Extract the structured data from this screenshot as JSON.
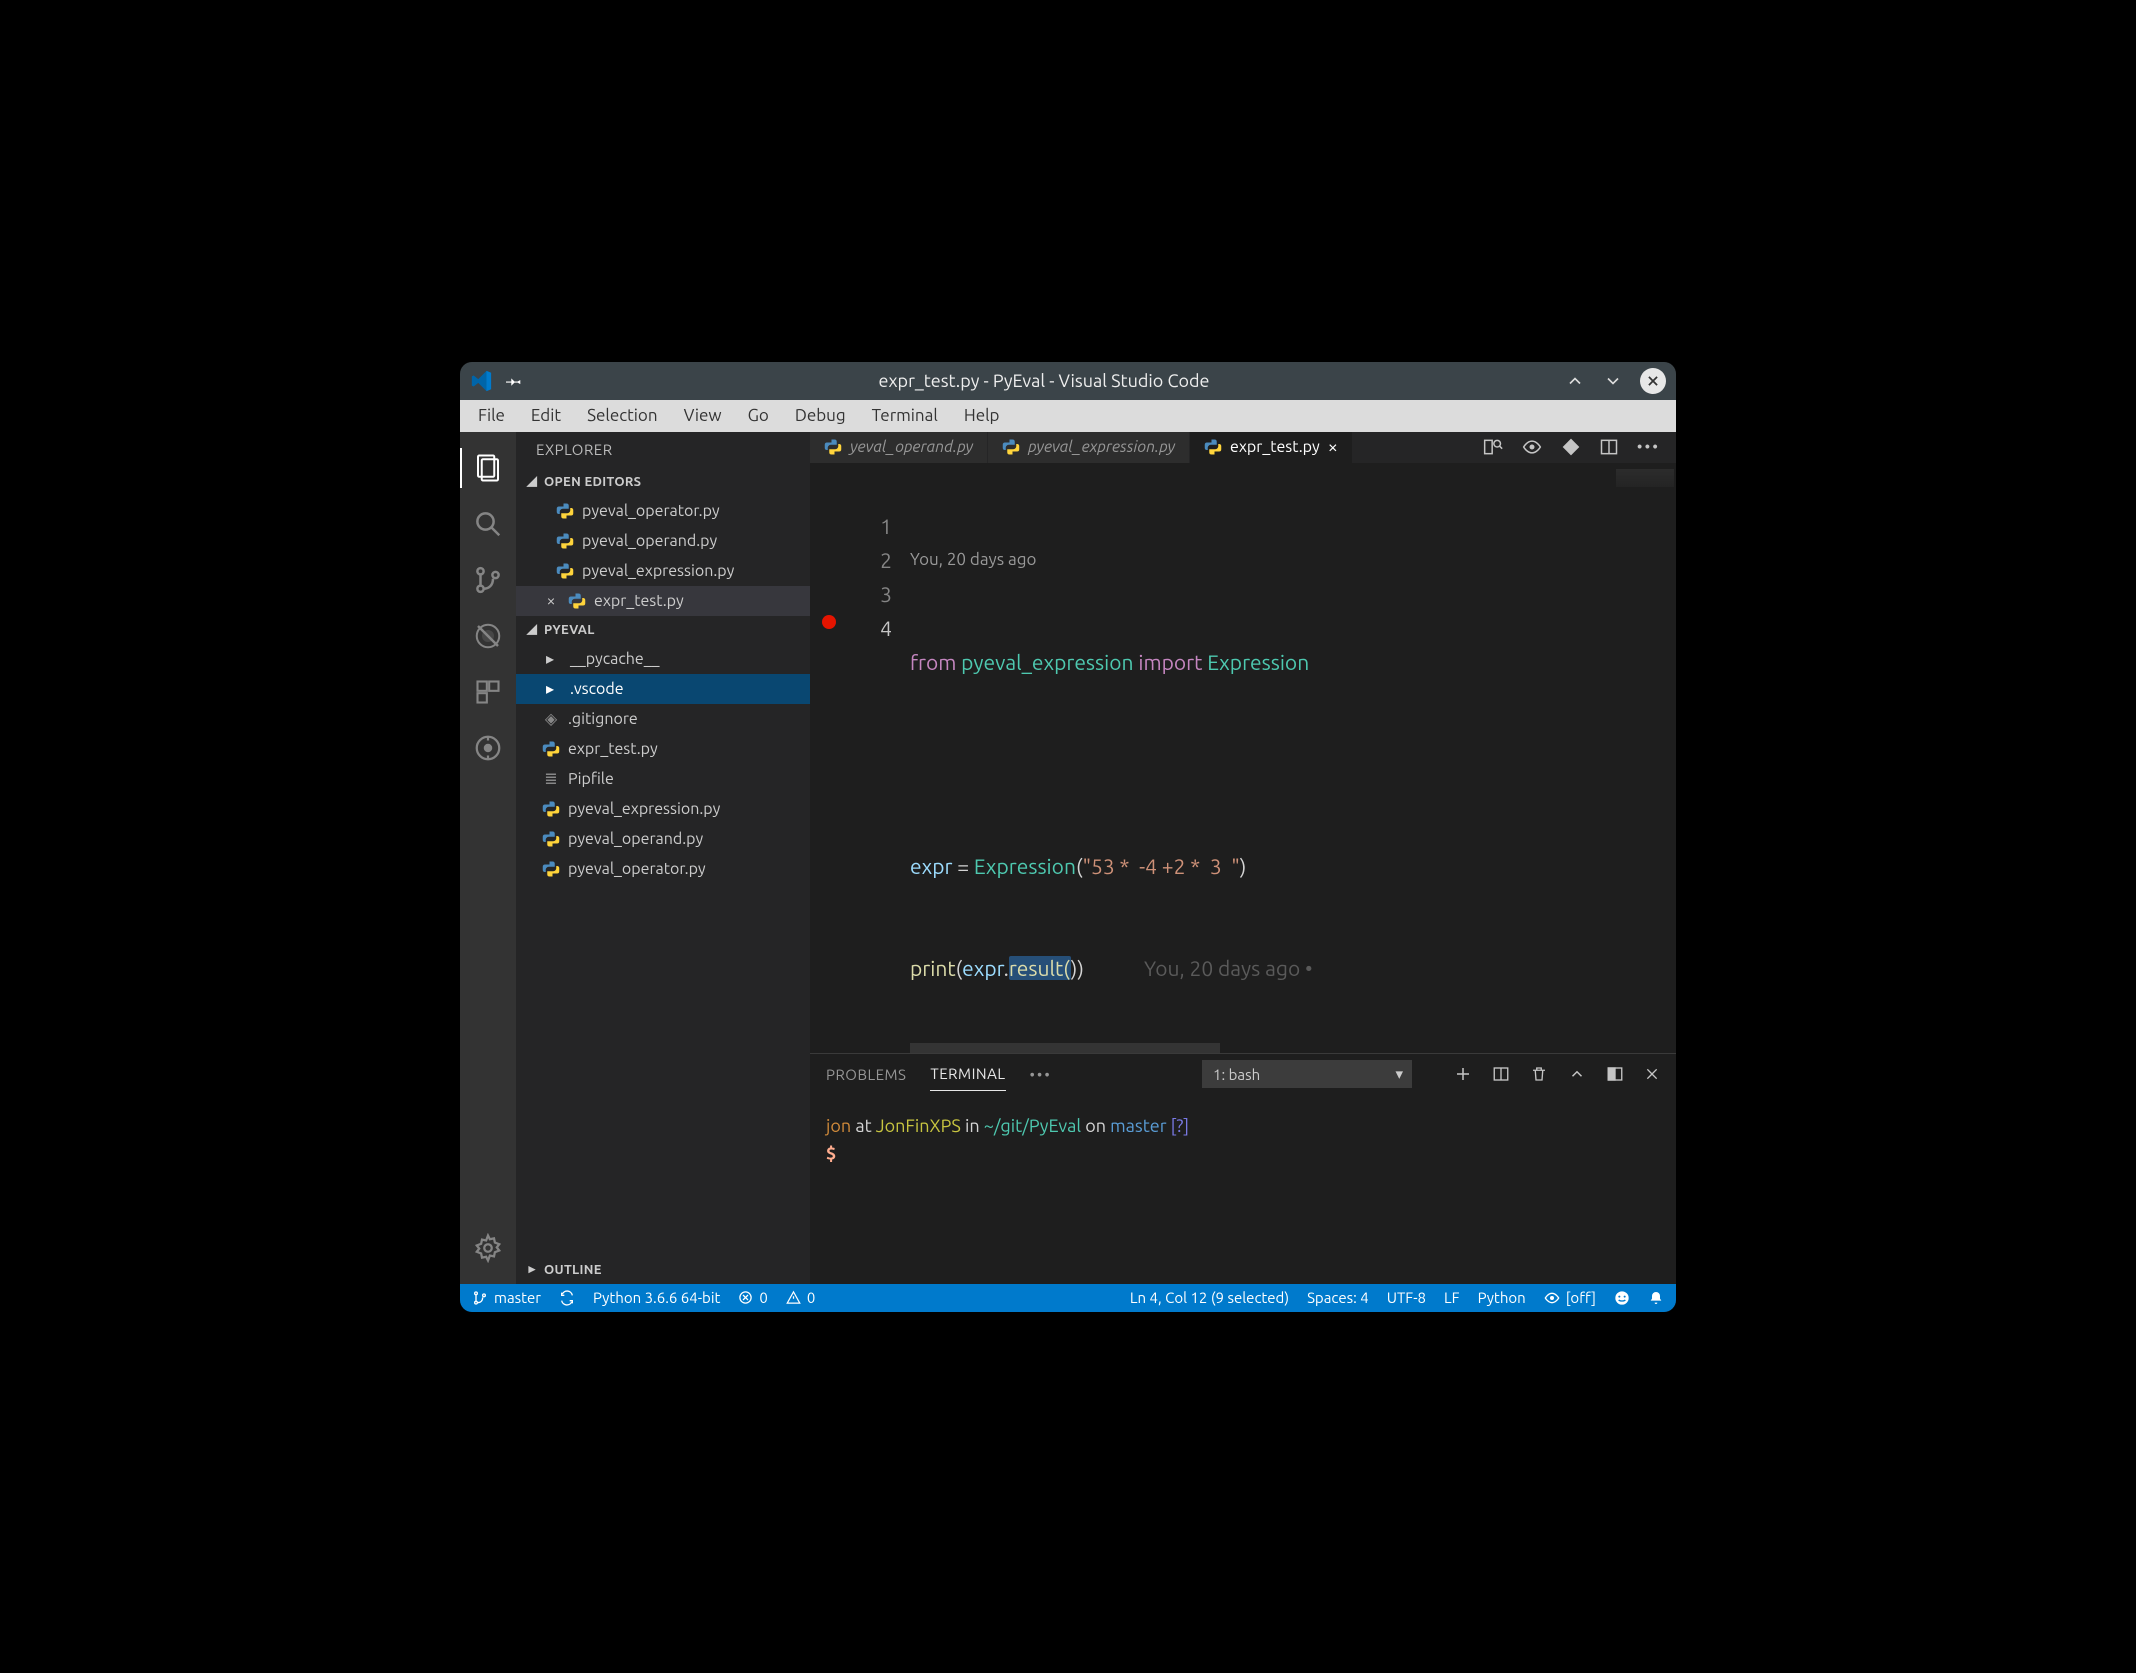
{
  "title": "expr_test.py - PyEval - Visual Studio Code",
  "menu": [
    "File",
    "Edit",
    "Selection",
    "View",
    "Go",
    "Debug",
    "Terminal",
    "Help"
  ],
  "sidebar": {
    "title": "EXPLORER",
    "sections": {
      "open_editors": {
        "label": "OPEN EDITORS",
        "items": [
          {
            "label": "pyeval_operator.py",
            "active": false,
            "dirty": false
          },
          {
            "label": "pyeval_operand.py",
            "active": false,
            "dirty": false
          },
          {
            "label": "pyeval_expression.py",
            "active": false,
            "dirty": false
          },
          {
            "label": "expr_test.py",
            "active": true,
            "dirty": false
          }
        ]
      },
      "project": {
        "label": "PYEVAL",
        "items": [
          {
            "label": "__pycache__",
            "type": "folder"
          },
          {
            "label": ".vscode",
            "type": "folder",
            "selected": true
          },
          {
            "label": ".gitignore",
            "type": "git"
          },
          {
            "label": "expr_test.py",
            "type": "py"
          },
          {
            "label": "Pipfile",
            "type": "text"
          },
          {
            "label": "pyeval_expression.py",
            "type": "py"
          },
          {
            "label": "pyeval_operand.py",
            "type": "py"
          },
          {
            "label": "pyeval_operator.py",
            "type": "py"
          }
        ]
      },
      "outline": {
        "label": "OUTLINE"
      }
    }
  },
  "tabs": [
    {
      "label": "yeval_operand.py",
      "active": false
    },
    {
      "label": "pyeval_expression.py",
      "active": false
    },
    {
      "label": "expr_test.py",
      "active": true
    }
  ],
  "editor": {
    "codelens": "You, 20 days ago",
    "lines": [
      "1",
      "2",
      "3",
      "4"
    ],
    "breakpoint_line": 4,
    "code": {
      "l1_from": "from",
      "l1_mod": "pyeval_expression",
      "l1_import": "import",
      "l1_cls": "Expression",
      "l3_var": "expr",
      "l3_eq": " = ",
      "l3_cls": "Expression",
      "l3_open": "(",
      "l3_str": "\"53 *  -4 +2 *  3  \"",
      "l3_close": ")",
      "l4_print": "print",
      "l4_open": "(",
      "l4_var": "expr",
      "l4_dot": ".",
      "l4_sel": "result(",
      "l4_close": "))"
    },
    "inline_blame": "You, 20 days ago •"
  },
  "panel": {
    "tabs": [
      "PROBLEMS",
      "TERMINAL"
    ],
    "select": "1: bash",
    "prompt": {
      "user": "jon",
      "at": "at",
      "host": "JonFinXPS",
      "in": "in",
      "path": "~/git/PyEval",
      "on": "on",
      "branch": "master",
      "flag": "[?]",
      "ps": "$"
    }
  },
  "status": {
    "branch": "master",
    "python": "Python 3.6.6 64-bit",
    "err": "0",
    "warn": "0",
    "cursor": "Ln 4, Col 12 (9 selected)",
    "spaces": "Spaces: 4",
    "enc": "UTF-8",
    "eol": "LF",
    "lang": "Python",
    "live": "[off]"
  }
}
